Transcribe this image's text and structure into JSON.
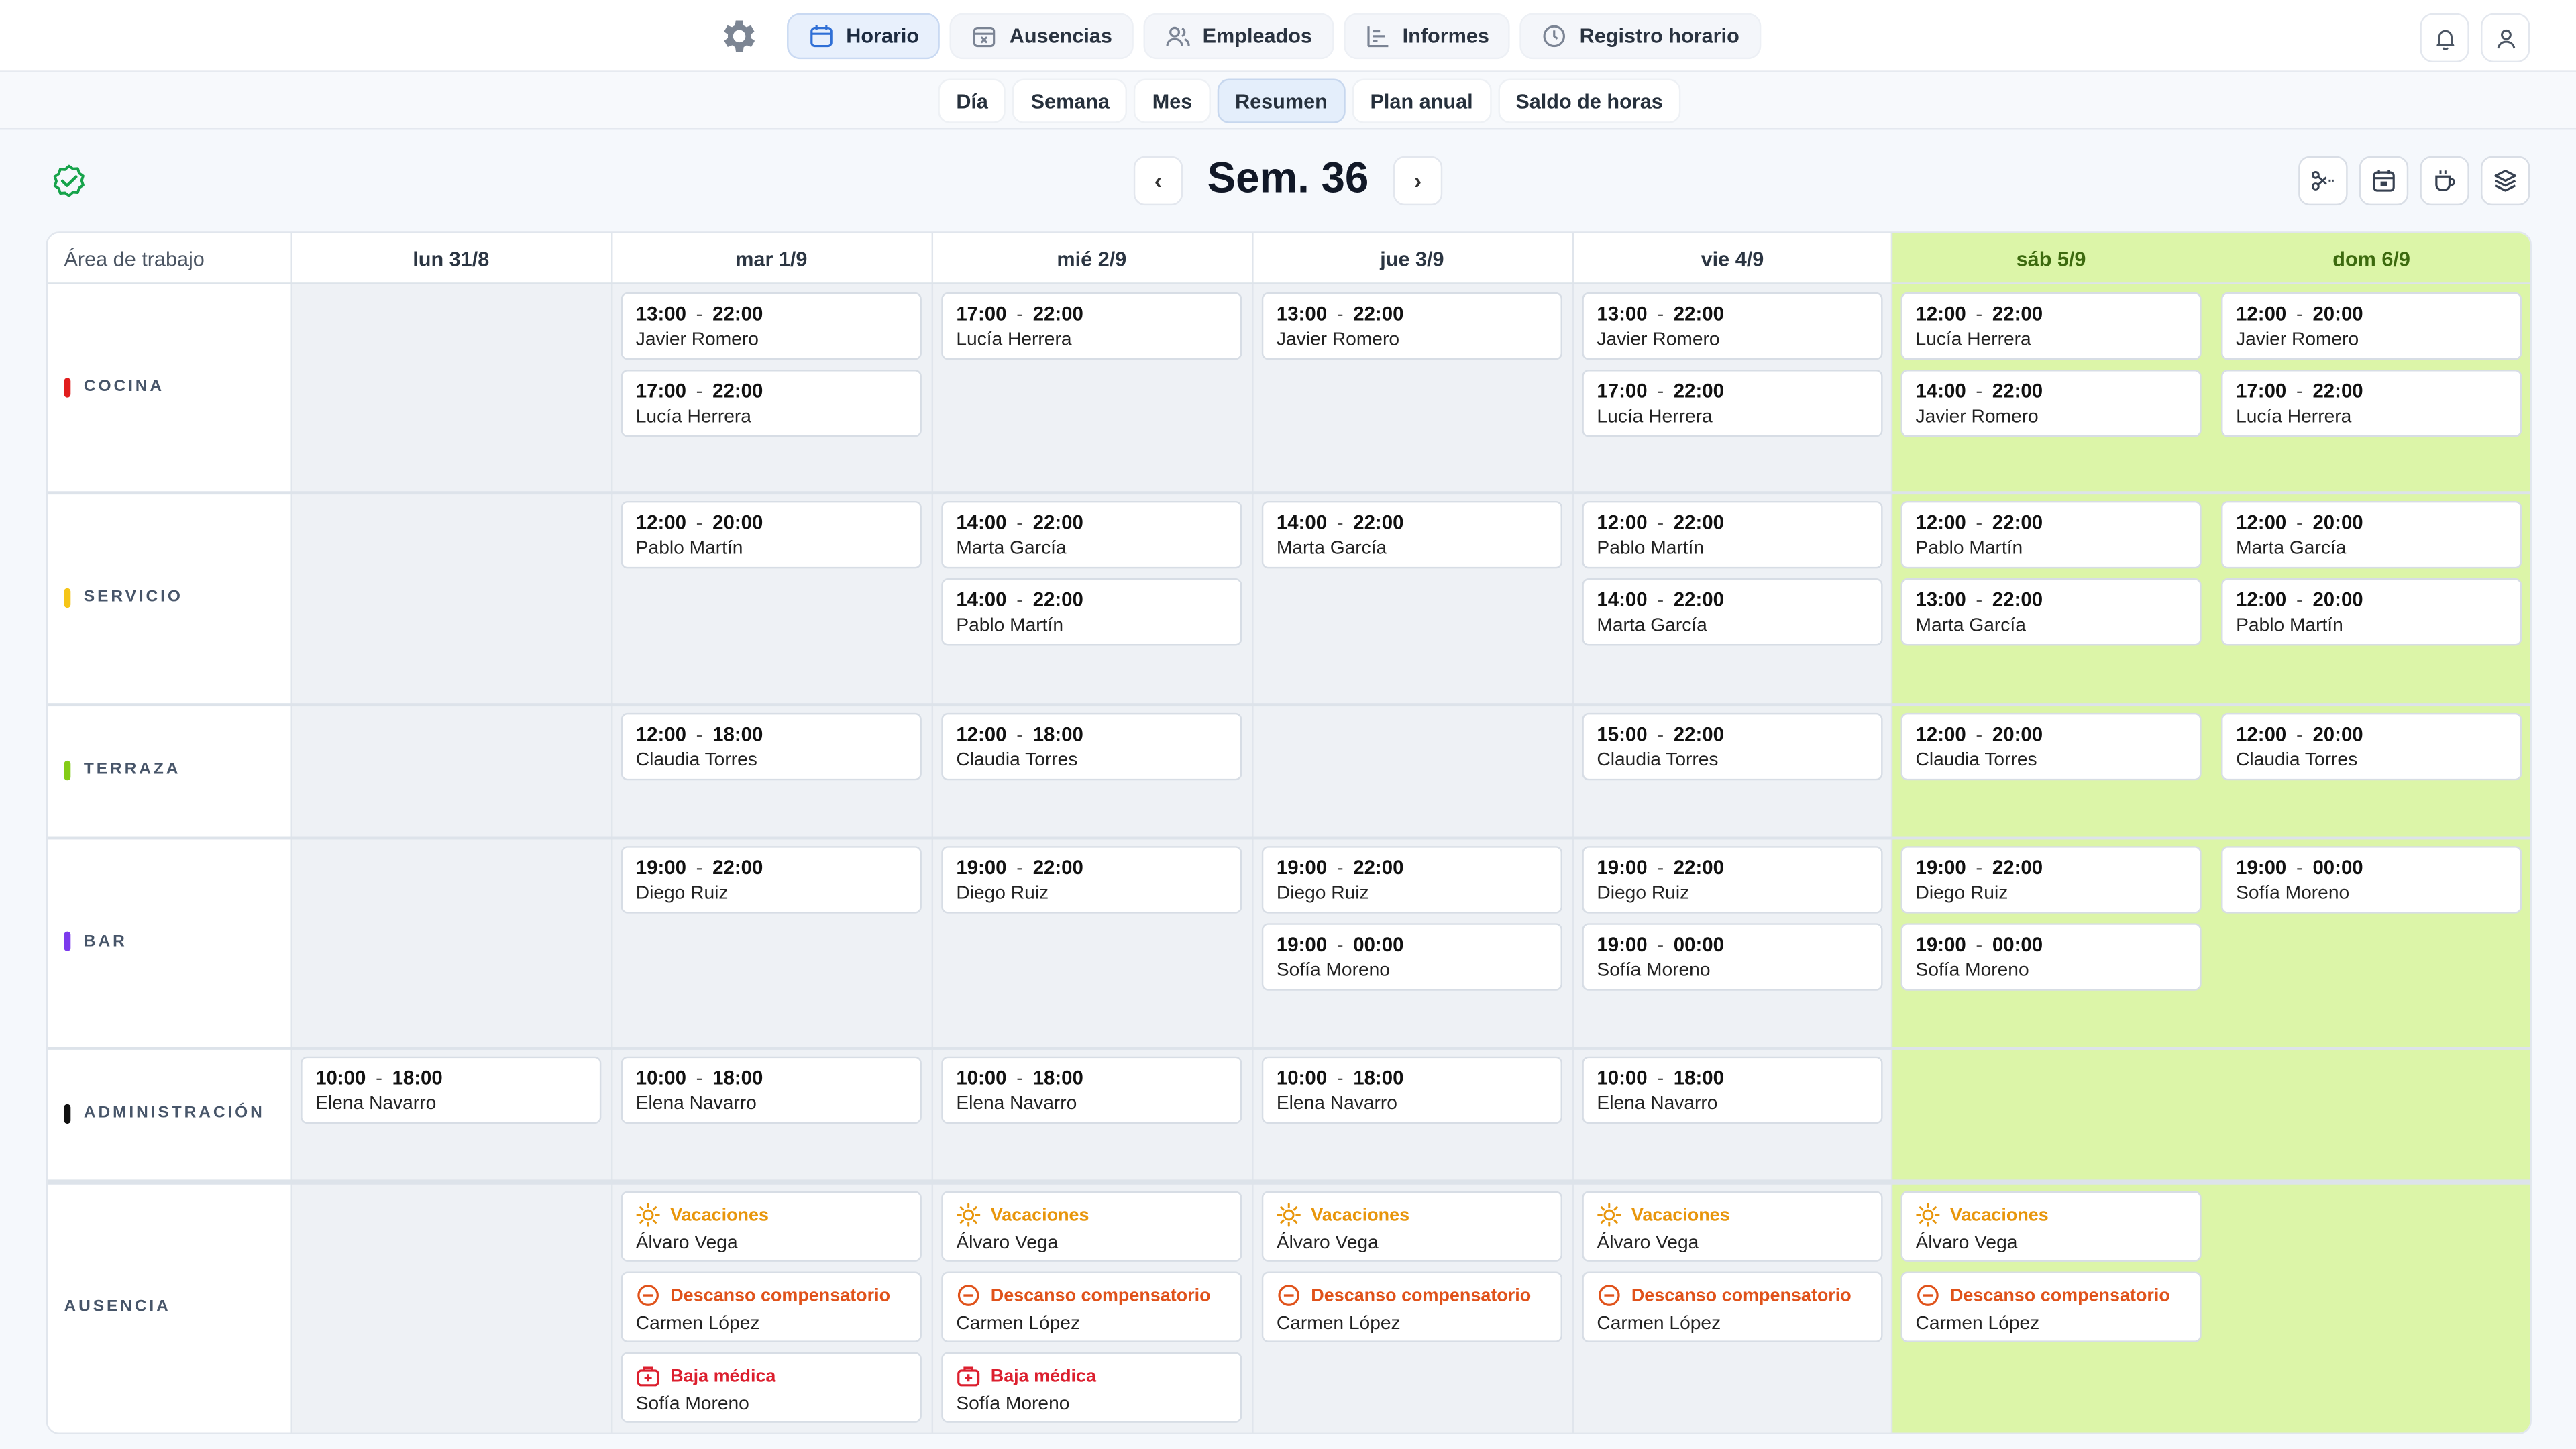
{
  "nav": {
    "items": [
      {
        "label": "Horario",
        "icon": "calendar-icon",
        "active": true
      },
      {
        "label": "Ausencias",
        "icon": "calendar-x-icon"
      },
      {
        "label": "Empleados",
        "icon": "users-icon"
      },
      {
        "label": "Informes",
        "icon": "bar-chart-icon"
      },
      {
        "label": "Registro horario",
        "icon": "clock-icon"
      }
    ]
  },
  "subnav": {
    "items": [
      "Día",
      "Semana",
      "Mes",
      "Resumen",
      "Plan anual",
      "Saldo de horas"
    ],
    "active": "Resumen"
  },
  "week": {
    "title": "Sem. 36",
    "prev": "‹",
    "next": "›"
  },
  "grid": {
    "area_header": "Área de trabajo",
    "days": [
      "lun 31/8",
      "mar 1/9",
      "mié 2/9",
      "jue 3/9",
      "vie 4/9",
      "sáb 5/9",
      "dom 6/9"
    ],
    "areas": [
      {
        "name": "COCINA",
        "color": "#e11d1d"
      },
      {
        "name": "SERVICIO",
        "color": "#f5c518"
      },
      {
        "name": "TERRAZA",
        "color": "#84cc16"
      },
      {
        "name": "BAR",
        "color": "#7c3aed"
      },
      {
        "name": "ADMINISTRACIÓN",
        "color": "#111111"
      },
      {
        "name": "AUSENCIA",
        "color": ""
      }
    ],
    "shifts": {
      "cocina": [
        [],
        [
          {
            "start": "13:00",
            "end": "22:00",
            "name": "Javier Romero"
          },
          {
            "start": "17:00",
            "end": "22:00",
            "name": "Lucía Herrera"
          }
        ],
        [
          {
            "start": "17:00",
            "end": "22:00",
            "name": "Lucía Herrera"
          }
        ],
        [
          {
            "start": "13:00",
            "end": "22:00",
            "name": "Javier Romero"
          }
        ],
        [
          {
            "start": "13:00",
            "end": "22:00",
            "name": "Javier Romero"
          },
          {
            "start": "17:00",
            "end": "22:00",
            "name": "Lucía Herrera"
          }
        ],
        [
          {
            "start": "12:00",
            "end": "22:00",
            "name": "Lucía Herrera"
          },
          {
            "start": "14:00",
            "end": "22:00",
            "name": "Javier Romero"
          }
        ],
        [
          {
            "start": "12:00",
            "end": "20:00",
            "name": "Javier Romero"
          },
          {
            "start": "17:00",
            "end": "22:00",
            "name": "Lucía Herrera"
          }
        ]
      ],
      "servicio": [
        [],
        [
          {
            "start": "12:00",
            "end": "20:00",
            "name": "Pablo Martín"
          }
        ],
        [
          {
            "start": "14:00",
            "end": "22:00",
            "name": "Marta García"
          },
          {
            "start": "14:00",
            "end": "22:00",
            "name": "Pablo Martín"
          }
        ],
        [
          {
            "start": "14:00",
            "end": "22:00",
            "name": "Marta García"
          }
        ],
        [
          {
            "start": "12:00",
            "end": "22:00",
            "name": "Pablo Martín"
          },
          {
            "start": "14:00",
            "end": "22:00",
            "name": "Marta García"
          }
        ],
        [
          {
            "start": "12:00",
            "end": "22:00",
            "name": "Pablo Martín"
          },
          {
            "start": "13:00",
            "end": "22:00",
            "name": "Marta García"
          }
        ],
        [
          {
            "start": "12:00",
            "end": "20:00",
            "name": "Marta García"
          },
          {
            "start": "12:00",
            "end": "20:00",
            "name": "Pablo Martín"
          }
        ]
      ],
      "terraza": [
        [],
        [
          {
            "start": "12:00",
            "end": "18:00",
            "name": "Claudia Torres"
          }
        ],
        [
          {
            "start": "12:00",
            "end": "18:00",
            "name": "Claudia Torres"
          }
        ],
        [],
        [
          {
            "start": "15:00",
            "end": "22:00",
            "name": "Claudia Torres"
          }
        ],
        [
          {
            "start": "12:00",
            "end": "20:00",
            "name": "Claudia Torres"
          }
        ],
        [
          {
            "start": "12:00",
            "end": "20:00",
            "name": "Claudia Torres"
          }
        ]
      ],
      "bar": [
        [],
        [
          {
            "start": "19:00",
            "end": "22:00",
            "name": "Diego Ruiz"
          }
        ],
        [
          {
            "start": "19:00",
            "end": "22:00",
            "name": "Diego Ruiz"
          }
        ],
        [
          {
            "start": "19:00",
            "end": "22:00",
            "name": "Diego Ruiz"
          },
          {
            "start": "19:00",
            "end": "00:00",
            "name": "Sofía Moreno"
          }
        ],
        [
          {
            "start": "19:00",
            "end": "22:00",
            "name": "Diego Ruiz"
          },
          {
            "start": "19:00",
            "end": "00:00",
            "name": "Sofía Moreno"
          }
        ],
        [
          {
            "start": "19:00",
            "end": "22:00",
            "name": "Diego Ruiz"
          },
          {
            "start": "19:00",
            "end": "00:00",
            "name": "Sofía Moreno"
          }
        ],
        [
          {
            "start": "19:00",
            "end": "00:00",
            "name": "Sofía Moreno"
          }
        ]
      ],
      "administracion": [
        [
          {
            "start": "10:00",
            "end": "18:00",
            "name": "Elena Navarro"
          }
        ],
        [
          {
            "start": "10:00",
            "end": "18:00",
            "name": "Elena Navarro"
          }
        ],
        [
          {
            "start": "10:00",
            "end": "18:00",
            "name": "Elena Navarro"
          }
        ],
        [
          {
            "start": "10:00",
            "end": "18:00",
            "name": "Elena Navarro"
          }
        ],
        [
          {
            "start": "10:00",
            "end": "18:00",
            "name": "Elena Navarro"
          }
        ],
        [],
        []
      ]
    },
    "absences": [
      [],
      [
        {
          "type": "Vacaciones",
          "kind": "sun",
          "color": "#e8960c",
          "name": "Álvaro Vega"
        },
        {
          "type": "Descanso compensatorio",
          "kind": "minus",
          "color": "#e0521a",
          "name": "Carmen López"
        },
        {
          "type": "Baja médica",
          "kind": "medkit",
          "color": "#dc1f2e",
          "name": "Sofía Moreno"
        }
      ],
      [
        {
          "type": "Vacaciones",
          "kind": "sun",
          "color": "#e8960c",
          "name": "Álvaro Vega"
        },
        {
          "type": "Descanso compensatorio",
          "kind": "minus",
          "color": "#e0521a",
          "name": "Carmen López"
        },
        {
          "type": "Baja médica",
          "kind": "medkit",
          "color": "#dc1f2e",
          "name": "Sofía Moreno"
        }
      ],
      [
        {
          "type": "Vacaciones",
          "kind": "sun",
          "color": "#e8960c",
          "name": "Álvaro Vega"
        },
        {
          "type": "Descanso compensatorio",
          "kind": "minus",
          "color": "#e0521a",
          "name": "Carmen López"
        }
      ],
      [
        {
          "type": "Vacaciones",
          "kind": "sun",
          "color": "#e8960c",
          "name": "Álvaro Vega"
        },
        {
          "type": "Descanso compensatorio",
          "kind": "minus",
          "color": "#e0521a",
          "name": "Carmen López"
        }
      ],
      [
        {
          "type": "Vacaciones",
          "kind": "sun",
          "color": "#e8960c",
          "name": "Álvaro Vega"
        },
        {
          "type": "Descanso compensatorio",
          "kind": "minus",
          "color": "#e0521a",
          "name": "Carmen López"
        }
      ],
      []
    ]
  },
  "colors": {
    "weekend": "#dcf5a8",
    "active_tab": "#e8f0fc",
    "check": "#16a34a"
  }
}
